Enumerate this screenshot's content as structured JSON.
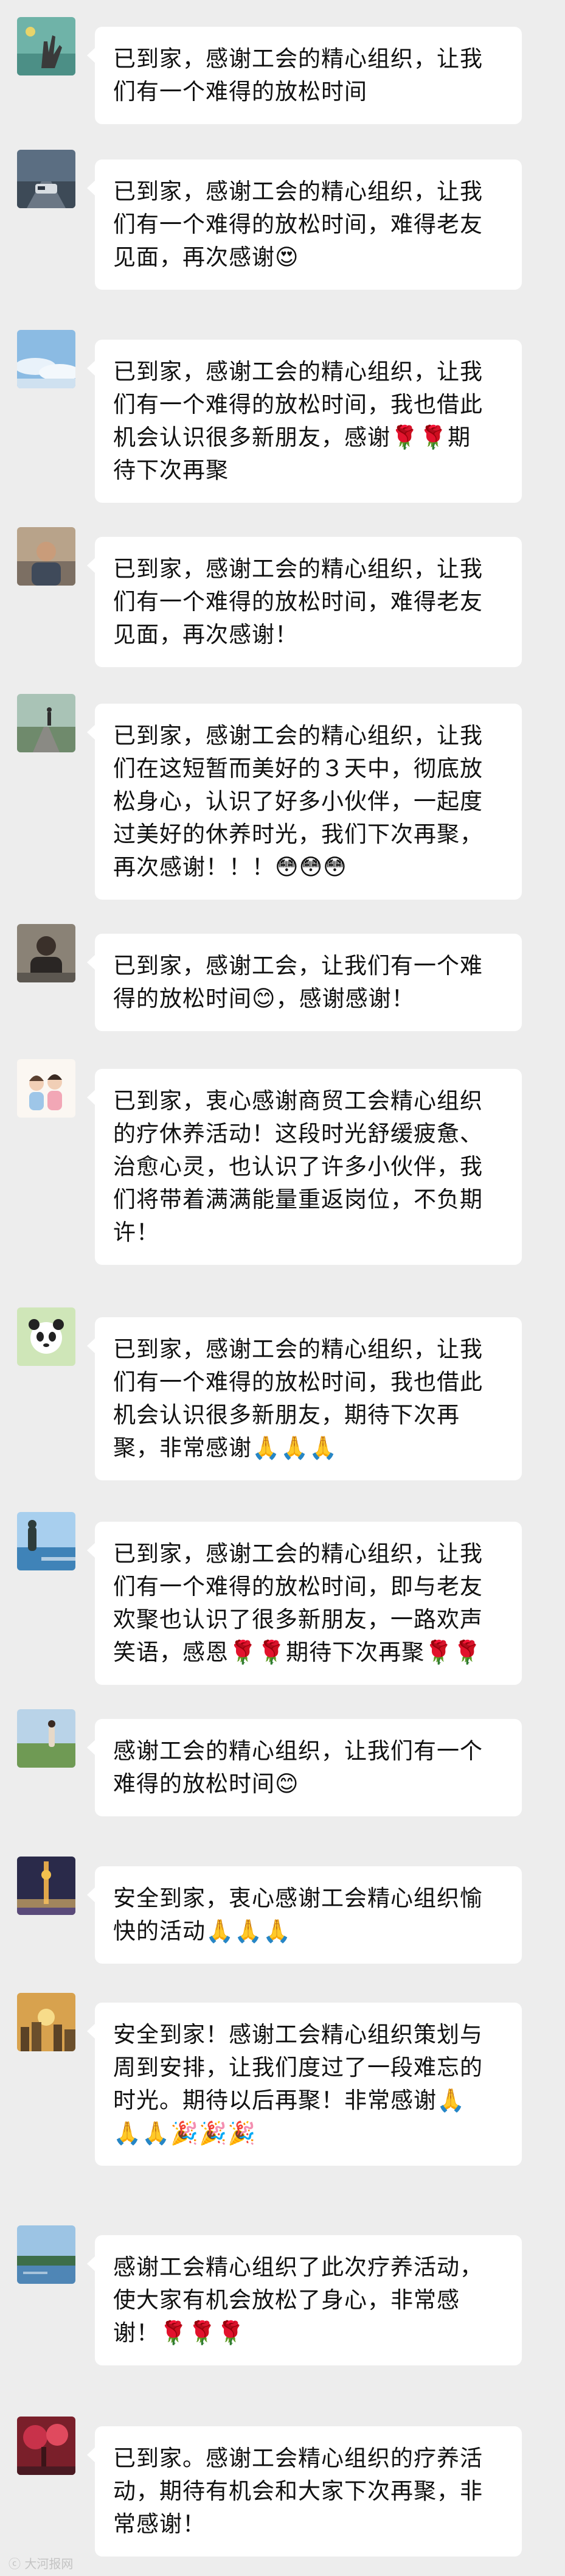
{
  "colors": {
    "background": "#ededed",
    "bubble": "#ffffff",
    "text": "#111111"
  },
  "messages": [
    {
      "avatar": "avatar-gesture-hand",
      "text": "已到家，感谢工会的精心组织，让我\n们有一个难得的放松时间"
    },
    {
      "avatar": "avatar-road-car",
      "text": "已到家，感谢工会的精心组织，让我\n们有一个难得的放松时间，难得老友\n见面，再次感谢😍"
    },
    {
      "avatar": "avatar-sky-clouds",
      "text": "已到家，感谢工会的精心组织，让我\n们有一个难得的放松时间，我也借此\n机会认识很多新朋友，感谢🌹🌹期\n待下次再聚"
    },
    {
      "avatar": "avatar-man-portrait",
      "text": "已到家，感谢工会的精心组织，让我\n们有一个难得的放松时间，难得老友\n见面，再次感谢！"
    },
    {
      "avatar": "avatar-railway-walker",
      "text": "已到家，感谢工会的精心组织，让我\n们在这短暂而美好的３天中，彻底放\n松身心，认识了好多小伙伴，一起度\n过美好的休养时光，我们下次再聚，\n再次感谢！！！😳😳😳"
    },
    {
      "avatar": "avatar-dark-portrait",
      "text": "已到家，感谢工会，让我们有一个难\n得的放松时间😊，感谢感谢！"
    },
    {
      "avatar": "avatar-cartoon-family",
      "text": "已到家，衷心感谢商贸工会精心组织\n的疗休养活动！这段时光舒缓疲惫、\n治愈心灵，也认识了许多小伙伴，我\n们将带着满满能量重返岗位，不负期\n许！"
    },
    {
      "avatar": "avatar-panda",
      "text": "已到家，感谢工会的精心组织，让我\n们有一个难得的放松时间，我也借此\n机会认识很多新朋友，期待下次再\n聚，非常感谢🙏🙏🙏"
    },
    {
      "avatar": "avatar-lakeside",
      "text": "已到家，感谢工会的精心组织，让我\n们有一个难得的放松时间，即与老友\n欢聚也认识了很多新朋友，一路欢声\n笑语，感恩🌹🌹期待下次再聚🌹🌹"
    },
    {
      "avatar": "avatar-field-person",
      "text": "感谢工会的精心组织，让我们有一个\n难得的放松时间😊"
    },
    {
      "avatar": "avatar-night-tower",
      "text": "安全到家，衷心感谢工会精心组织愉\n快的活动🙏🙏🙏"
    },
    {
      "avatar": "avatar-sunset-city",
      "text": "安全到家！感谢工会精心组织策划与\n周到安排，让我们度过了一段难忘的\n时光。期待以后再聚！非常感谢🙏\n🙏🙏🎉🎉🎉"
    },
    {
      "avatar": "avatar-river",
      "text": "感谢工会精心组织了此次疗养活动，\n使大家有机会放松了身心，非常感\n谢！🌹🌹🌹"
    },
    {
      "avatar": "avatar-red-scenery",
      "text": "已到家。感谢工会精心组织的疗养活\n动，期待有机会和大家下次再聚，非\n常感谢！"
    }
  ],
  "watermark": "ⓒ 大河报网"
}
